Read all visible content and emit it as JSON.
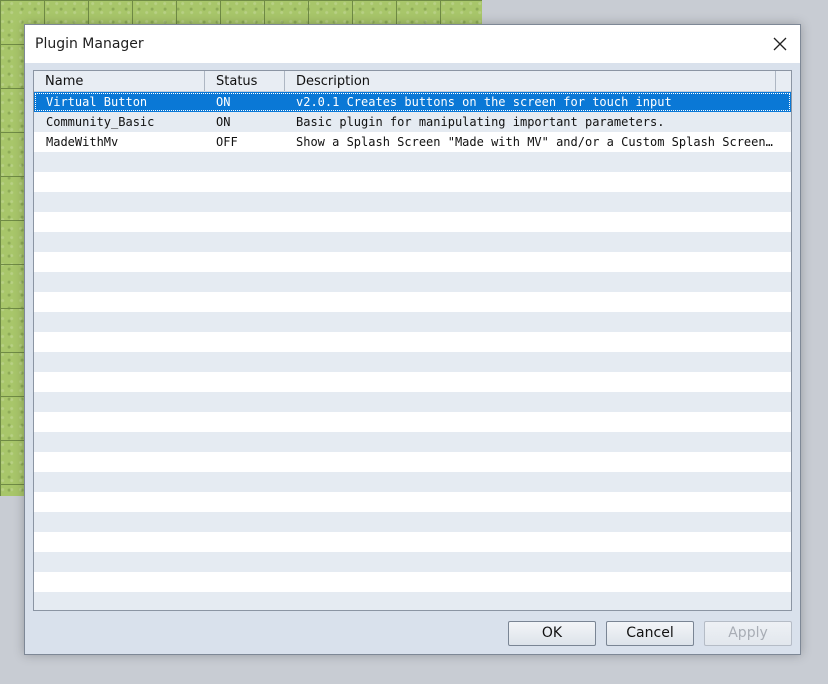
{
  "window": {
    "title": "Plugin Manager",
    "close_icon": "close-icon"
  },
  "table": {
    "columns": [
      "Name",
      "Status",
      "Description"
    ],
    "rows": [
      {
        "name": "Virtual Button",
        "status": "ON",
        "description": "v2.0.1 Creates buttons on the screen for touch input",
        "selected": true
      },
      {
        "name": "Community_Basic",
        "status": "ON",
        "description": "Basic plugin for manipulating important parameters.",
        "selected": false
      },
      {
        "name": "MadeWithMv",
        "status": "OFF",
        "description": "Show a Splash Screen \"Made with MV\" and/or a Custom Splash Screen be…",
        "selected": false
      }
    ]
  },
  "buttons": {
    "ok_label": "OK",
    "cancel_label": "Cancel",
    "apply_label": "Apply",
    "apply_enabled": false
  },
  "colors": {
    "selection": "#0a78d6",
    "stripe": "#e5ebf2",
    "dialog_bg": "#d9e1ec"
  }
}
